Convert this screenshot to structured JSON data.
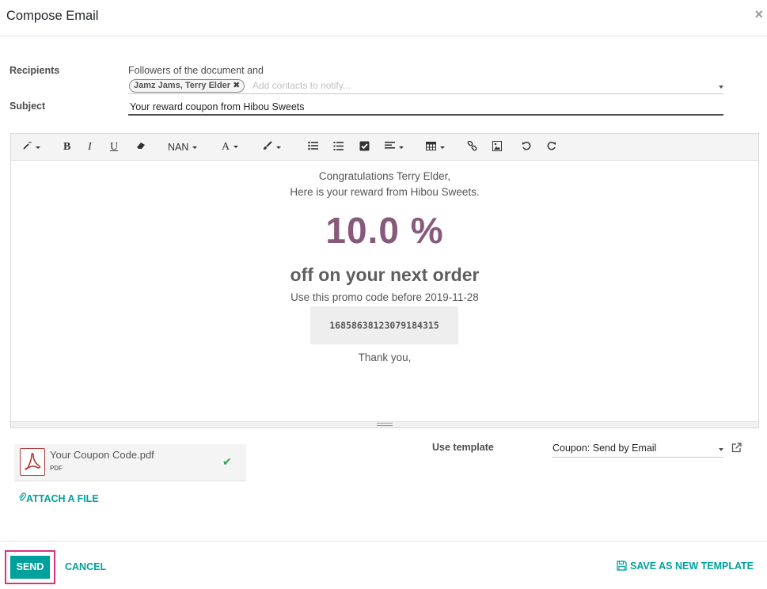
{
  "dialog": {
    "title": "Compose Email",
    "close_glyph": "×"
  },
  "recipients": {
    "label": "Recipients",
    "followers_text": "Followers of the document and",
    "tags": [
      {
        "label": "Jamz Jams, Terry Elder",
        "remove_glyph": "✖"
      }
    ],
    "placeholder": "Add contacts to notify..."
  },
  "subject": {
    "label": "Subject",
    "value": "Your reward coupon from Hibou Sweets"
  },
  "toolbar": {
    "style_glyph": "✎",
    "bold": "B",
    "italic": "I",
    "underline": "U",
    "font_size": "NAN",
    "font_color": "A",
    "icons": [
      "magic-wand-icon",
      "eraser-icon",
      "paint-brush-icon",
      "unordered-list-icon",
      "ordered-list-icon",
      "checklist-icon",
      "paragraph-align-icon",
      "table-icon",
      "link-icon",
      "image-icon",
      "undo-icon",
      "redo-icon"
    ]
  },
  "body": {
    "greeting": "Congratulations Terry Elder,",
    "intro": "Here is your reward from Hibou Sweets.",
    "discount": "10.0 %",
    "offer": "off on your next order",
    "promo_text": "Use this promo code before 2019-11-28",
    "code": "16858638123079184315",
    "closing": "Thank you,"
  },
  "attachments": [
    {
      "name": "Your Coupon Code.pdf",
      "ext": "PDF",
      "status": "✔"
    }
  ],
  "attach_link": "ATTACH A FILE",
  "template": {
    "label": "Use template",
    "value": "Coupon: Send by Email"
  },
  "footer": {
    "send": "SEND",
    "cancel": "CANCEL",
    "save_template": "SAVE AS NEW TEMPLATE"
  },
  "colors": {
    "accent": "#00a09d",
    "brand": "#875a7b",
    "highlight": "#d6337d"
  }
}
